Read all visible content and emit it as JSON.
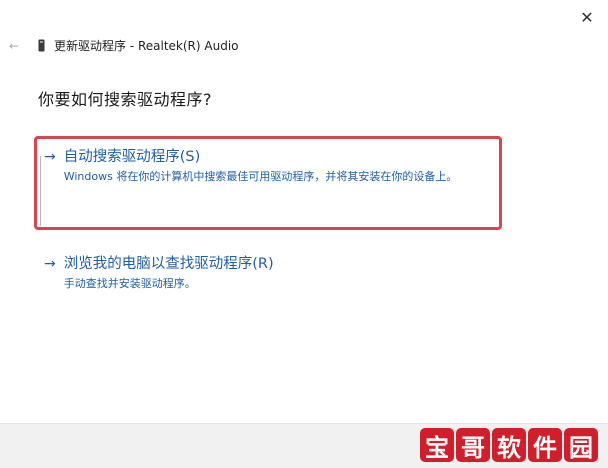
{
  "window": {
    "close_glyph": "✕",
    "back_glyph": "←",
    "title": "更新驱动程序 - Realtek(R) Audio"
  },
  "main": {
    "heading": "你要如何搜索驱动程序?",
    "options": [
      {
        "arrow": "→",
        "label": "自动搜索驱动程序(S)",
        "description": "Windows 将在你的计算机中搜索最佳可用驱动程序，并将其安装在你的设备上。",
        "highlighted": true
      },
      {
        "arrow": "→",
        "label": "浏览我的电脑以查找驱动程序(R)",
        "description": "手动查找并安装驱动程序。",
        "highlighted": false
      }
    ]
  },
  "watermark": {
    "chars": [
      "宝",
      "哥",
      "软",
      "件",
      "园"
    ]
  },
  "colors": {
    "link": "#1f5fa8",
    "highlight_border": "#d64550",
    "watermark_bg": "#d21e2a"
  },
  "icons": {
    "device": "device-icon",
    "close": "close-icon",
    "back": "back-arrow-icon"
  }
}
